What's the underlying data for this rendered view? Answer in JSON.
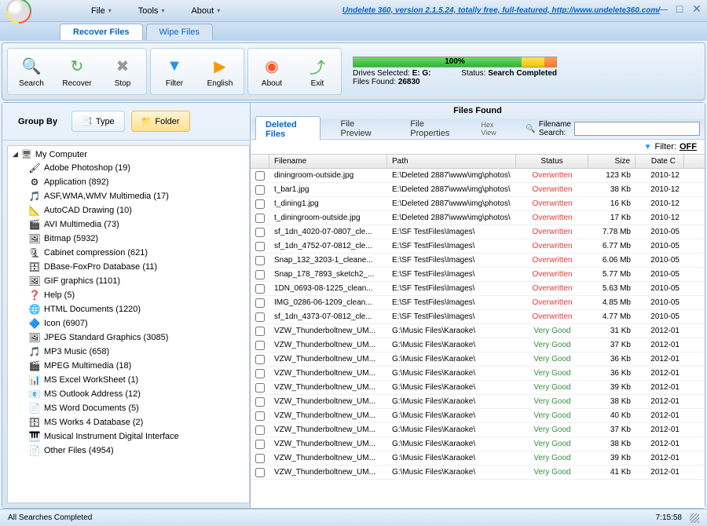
{
  "menu": {
    "file": "File",
    "tools": "Tools",
    "about": "About"
  },
  "promo": "Undelete 360, version 2.1.5.24, totally free, full-featured, http://www.undelete360.com/",
  "tabs": {
    "recover": "Recover Files",
    "wipe": "Wipe Files"
  },
  "toolbar": {
    "search": "Search",
    "recover": "Recover",
    "stop": "Stop",
    "filter": "Filter",
    "english": "English",
    "about": "About",
    "exit": "Exit"
  },
  "status": {
    "percent": "100%",
    "label": "Status:",
    "value": "Search Completed",
    "drives_label": "Drives Selected:",
    "drives": "E: G:",
    "files_label": "Files Found:",
    "files": "26830"
  },
  "groupby": {
    "label": "Group By",
    "type": "Type",
    "folder": "Folder"
  },
  "tree": {
    "root": "My Computer",
    "items": [
      {
        "icon": "🖌",
        "label": "Adobe Photoshop (19)"
      },
      {
        "icon": "⚙",
        "label": "Application (892)"
      },
      {
        "icon": "🎵",
        "label": "ASF,WMA,WMV Multimedia (17)"
      },
      {
        "icon": "📐",
        "label": "AutoCAD Drawing (10)"
      },
      {
        "icon": "🎬",
        "label": "AVI Multimedia (73)"
      },
      {
        "icon": "🖼",
        "label": "Bitmap (5932)"
      },
      {
        "icon": "🗜",
        "label": "Cabinet compression (621)"
      },
      {
        "icon": "🗄",
        "label": "DBase-FoxPro Database (11)"
      },
      {
        "icon": "🖼",
        "label": "GIF graphics (1101)"
      },
      {
        "icon": "❓",
        "label": "Help (5)"
      },
      {
        "icon": "🌐",
        "label": "HTML Documents (1220)"
      },
      {
        "icon": "🔷",
        "label": "Icon (6907)"
      },
      {
        "icon": "🖼",
        "label": "JPEG Standard Graphics (3085)"
      },
      {
        "icon": "🎵",
        "label": "MP3 Music (658)"
      },
      {
        "icon": "🎬",
        "label": "MPEG Multimedia (18)"
      },
      {
        "icon": "📊",
        "label": "MS Excel WorkSheet (1)"
      },
      {
        "icon": "📧",
        "label": "MS Outlook Address (12)"
      },
      {
        "icon": "📄",
        "label": "MS Word Documents (5)"
      },
      {
        "icon": "🗄",
        "label": "MS Works 4 Database (2)"
      },
      {
        "icon": "🎹",
        "label": "Musical Instrument Digital Interface"
      },
      {
        "icon": "📄",
        "label": "Other Files (4954)"
      }
    ]
  },
  "content": {
    "title": "Files Found",
    "tabs": {
      "deleted": "Deleted Files",
      "preview": "File Preview",
      "properties": "File Properties",
      "hex": "Hex View"
    },
    "search_label": "Filename Search:",
    "filter_label": "Filter:",
    "filter_value": "OFF"
  },
  "table": {
    "headers": {
      "filename": "Filename",
      "path": "Path",
      "status": "Status",
      "size": "Size",
      "date": "Date C"
    },
    "rows": [
      {
        "name": "diningroom-outside.jpg",
        "path": "E:\\Deleted 2887\\www\\img\\photos\\",
        "status": "Overwritten",
        "size": "123 Kb",
        "date": "2010-12"
      },
      {
        "name": "t_bar1.jpg",
        "path": "E:\\Deleted 2887\\www\\img\\photos\\",
        "status": "Overwritten",
        "size": "38 Kb",
        "date": "2010-12"
      },
      {
        "name": "t_dining1.jpg",
        "path": "E:\\Deleted 2887\\www\\img\\photos\\",
        "status": "Overwritten",
        "size": "16 Kb",
        "date": "2010-12"
      },
      {
        "name": "t_diningroom-outside.jpg",
        "path": "E:\\Deleted 2887\\www\\img\\photos\\",
        "status": "Overwritten",
        "size": "17 Kb",
        "date": "2010-12"
      },
      {
        "name": "sf_1dn_4020-07-0807_cle...",
        "path": "E:\\SF TestFiles\\Images\\",
        "status": "Overwritten",
        "size": "7.78 Mb",
        "date": "2010-05"
      },
      {
        "name": "sf_1dn_4752-07-0812_cle...",
        "path": "E:\\SF TestFiles\\Images\\",
        "status": "Overwritten",
        "size": "6.77 Mb",
        "date": "2010-05"
      },
      {
        "name": "Snap_132_3203-1_cleane...",
        "path": "E:\\SF TestFiles\\Images\\",
        "status": "Overwritten",
        "size": "6.06 Mb",
        "date": "2010-05"
      },
      {
        "name": "Snap_178_7893_sketch2_...",
        "path": "E:\\SF TestFiles\\Images\\",
        "status": "Overwritten",
        "size": "5.77 Mb",
        "date": "2010-05"
      },
      {
        "name": "1DN_0693-08-1225_clean...",
        "path": "E:\\SF TestFiles\\Images\\",
        "status": "Overwritten",
        "size": "5.63 Mb",
        "date": "2010-05"
      },
      {
        "name": "IMG_0286-06-1209_clean...",
        "path": "E:\\SF TestFiles\\Images\\",
        "status": "Overwritten",
        "size": "4.85 Mb",
        "date": "2010-05"
      },
      {
        "name": "sf_1dn_4373-07-0812_cle...",
        "path": "E:\\SF TestFiles\\Images\\",
        "status": "Overwritten",
        "size": "4.77 Mb",
        "date": "2010-05"
      },
      {
        "name": "VZW_Thunderboltnew_UM...",
        "path": "G:\\Music Files\\Karaoke\\",
        "status": "Very Good",
        "size": "31 Kb",
        "date": "2012-01"
      },
      {
        "name": "VZW_Thunderboltnew_UM...",
        "path": "G:\\Music Files\\Karaoke\\",
        "status": "Very Good",
        "size": "37 Kb",
        "date": "2012-01"
      },
      {
        "name": "VZW_Thunderboltnew_UM...",
        "path": "G:\\Music Files\\Karaoke\\",
        "status": "Very Good",
        "size": "36 Kb",
        "date": "2012-01"
      },
      {
        "name": "VZW_Thunderboltnew_UM...",
        "path": "G:\\Music Files\\Karaoke\\",
        "status": "Very Good",
        "size": "36 Kb",
        "date": "2012-01"
      },
      {
        "name": "VZW_Thunderboltnew_UM...",
        "path": "G:\\Music Files\\Karaoke\\",
        "status": "Very Good",
        "size": "39 Kb",
        "date": "2012-01"
      },
      {
        "name": "VZW_Thunderboltnew_UM...",
        "path": "G:\\Music Files\\Karaoke\\",
        "status": "Very Good",
        "size": "38 Kb",
        "date": "2012-01"
      },
      {
        "name": "VZW_Thunderboltnew_UM...",
        "path": "G:\\Music Files\\Karaoke\\",
        "status": "Very Good",
        "size": "40 Kb",
        "date": "2012-01"
      },
      {
        "name": "VZW_Thunderboltnew_UM...",
        "path": "G:\\Music Files\\Karaoke\\",
        "status": "Very Good",
        "size": "37 Kb",
        "date": "2012-01"
      },
      {
        "name": "VZW_Thunderboltnew_UM...",
        "path": "G:\\Music Files\\Karaoke\\",
        "status": "Very Good",
        "size": "38 Kb",
        "date": "2012-01"
      },
      {
        "name": "VZW_Thunderboltnew_UM...",
        "path": "G:\\Music Files\\Karaoke\\",
        "status": "Very Good",
        "size": "39 Kb",
        "date": "2012-01"
      },
      {
        "name": "VZW_Thunderboltnew_UM...",
        "path": "G:\\Music Files\\Karaoke\\",
        "status": "Very Good",
        "size": "41 Kb",
        "date": "2012-01"
      }
    ]
  },
  "statusbar": {
    "left": "All Searches Completed",
    "time": "7:15:58"
  }
}
